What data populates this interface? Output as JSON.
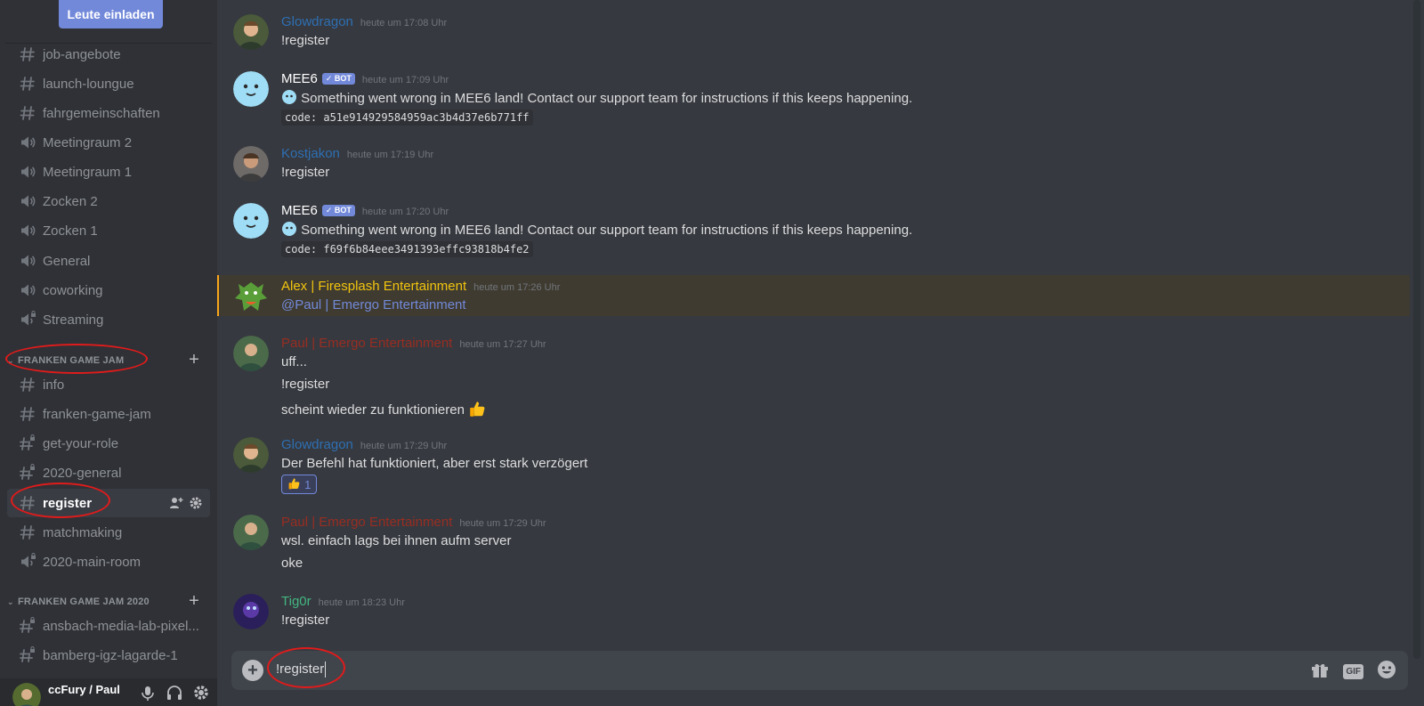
{
  "sidebar": {
    "invite_label": "Leute einladen",
    "channels_top": [
      {
        "label": "job-angebote",
        "type": "text"
      },
      {
        "label": "launch-loungue",
        "type": "text"
      },
      {
        "label": "fahrgemeinschaften",
        "type": "text"
      },
      {
        "label": "Meetingraum 2",
        "type": "voice"
      },
      {
        "label": "Meetingraum 1",
        "type": "voice"
      },
      {
        "label": "Zocken 2",
        "type": "voice"
      },
      {
        "label": "Zocken 1",
        "type": "voice"
      },
      {
        "label": "General",
        "type": "voice"
      },
      {
        "label": "coworking",
        "type": "voice"
      },
      {
        "label": "Streaming",
        "type": "voice-locked"
      }
    ],
    "category_1": "FRANKEN GAME JAM",
    "channels_cat1": [
      {
        "label": "info",
        "type": "text"
      },
      {
        "label": "franken-game-jam",
        "type": "text"
      },
      {
        "label": "get-your-role",
        "type": "text-locked"
      },
      {
        "label": "2020-general",
        "type": "text-locked"
      },
      {
        "label": "register",
        "type": "text",
        "active": true
      },
      {
        "label": "matchmaking",
        "type": "text"
      },
      {
        "label": "2020-main-room",
        "type": "voice-locked"
      }
    ],
    "category_2": "FRANKEN GAME JAM 2020",
    "channels_cat2": [
      {
        "label": "ansbach-media-lab-pixel...",
        "type": "text-locked"
      },
      {
        "label": "bamberg-igz-lagarde-1",
        "type": "text-locked"
      }
    ]
  },
  "user_panel": {
    "username": "ccFury / Paul"
  },
  "messages": [
    {
      "author": "Glowdragon",
      "color": "#2e6fb3",
      "timestamp": "heute um 17:08 Uhr",
      "lines": [
        "!register"
      ]
    },
    {
      "author": "MEE6",
      "color": "#ffffff",
      "bot_tag": "BOT",
      "timestamp": "heute um 17:09 Uhr",
      "lines": [
        "Something went wrong in MEE6 land! Contact our support team for instructions if this keeps happening."
      ],
      "code": "code: a51e914929584959ac3b4d37e6b771ff"
    },
    {
      "author": "Kostjakon",
      "color": "#2e6fb3",
      "timestamp": "heute um 17:19 Uhr",
      "lines": [
        "!register"
      ]
    },
    {
      "author": "MEE6",
      "color": "#ffffff",
      "bot_tag": "BOT",
      "timestamp": "heute um 17:20 Uhr",
      "lines": [
        "Something went wrong in MEE6 land! Contact our support team for instructions if this keeps happening."
      ],
      "code": "code: f69f6b84eee3491393effc93818b4fe2"
    },
    {
      "author": "Alex | Firesplash Entertainment",
      "color": "#f1c40f",
      "timestamp": "heute um 17:26 Uhr",
      "mention": "@Paul | Emergo Entertainment"
    },
    {
      "author": "Paul | Emergo Entertainment",
      "color": "#992d22",
      "timestamp": "heute um 17:27 Uhr",
      "lines": [
        "uff...",
        "!register",
        "scheint wieder zu funktionieren"
      ]
    },
    {
      "author": "Glowdragon",
      "color": "#2e6fb3",
      "timestamp": "heute um 17:29 Uhr",
      "lines": [
        "Der Befehl hat funktioniert, aber erst stark verzögert"
      ],
      "reaction_count": "1"
    },
    {
      "author": "Paul | Emergo Entertainment",
      "color": "#992d22",
      "timestamp": "heute um 17:29 Uhr",
      "lines": [
        "wsl. einfach lags bei ihnen aufm server",
        "oke"
      ]
    },
    {
      "author": "Tig0r",
      "color": "#43b581",
      "timestamp": "heute um 18:23 Uhr",
      "lines": [
        "!register"
      ]
    }
  ],
  "composer": {
    "value": "!register",
    "gif_label": "GIF"
  },
  "colors": {
    "accent": "#7289da",
    "annotation": "#e01b1b",
    "mention_bar": "#faa61a"
  }
}
